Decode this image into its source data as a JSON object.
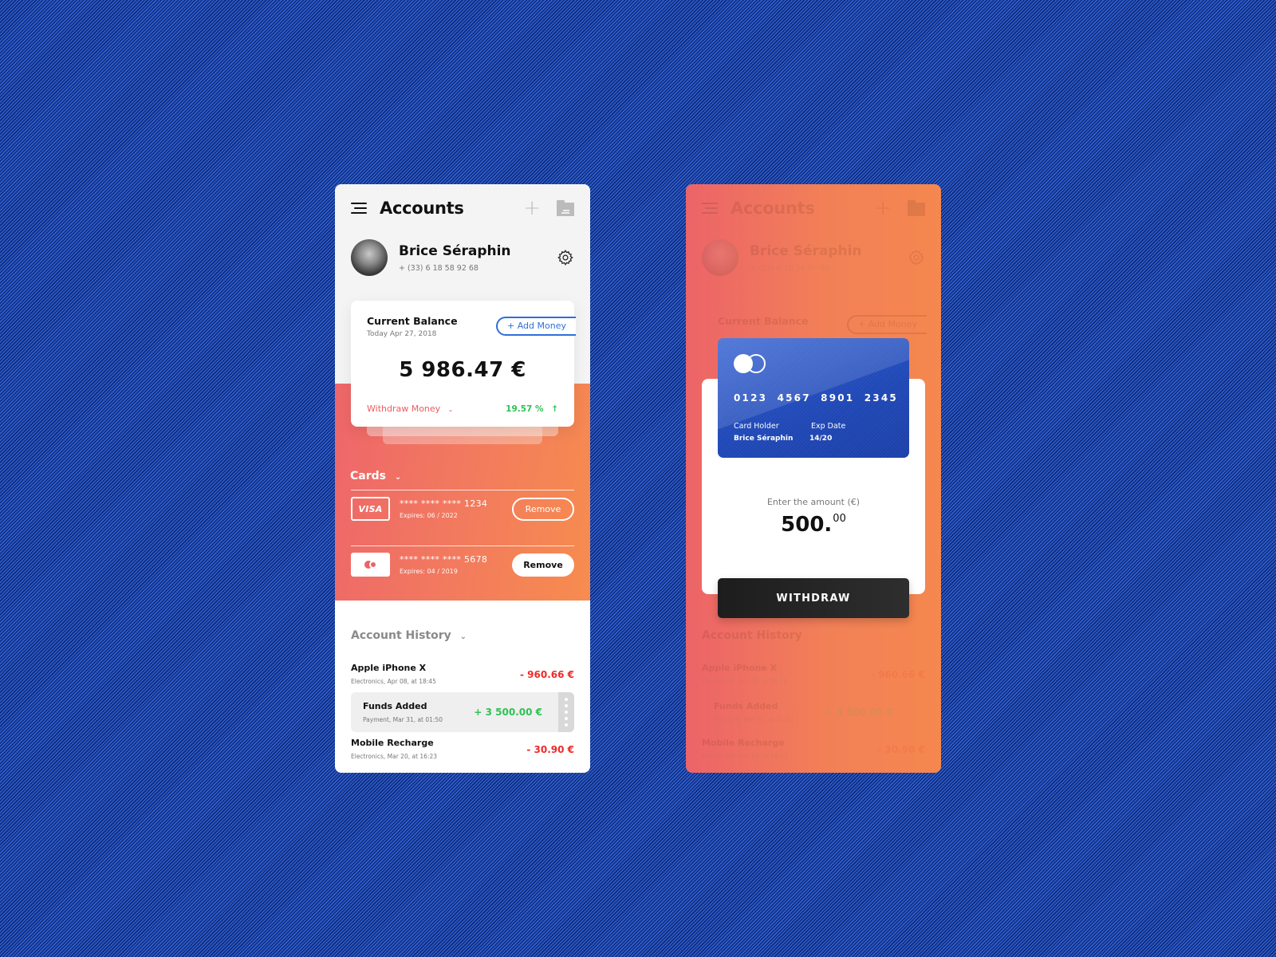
{
  "header": {
    "title": "Accounts",
    "menu_icon": "hamburger-menu-icon",
    "add_icon": "plus-icon",
    "folder_icon": "folder-icon"
  },
  "profile": {
    "name": "Brice Séraphin",
    "phone": "+ (33) 6 18 58 92 68",
    "settings_icon": "gear-icon"
  },
  "balance": {
    "title": "Current Balance",
    "date": "Today Apr 27, 2018",
    "add_money_label": "+ Add Money",
    "amount": "5 986.47 €",
    "withdraw_label": "Withdraw Money",
    "growth": "19.57 %"
  },
  "cards": {
    "title": "Cards",
    "items": [
      {
        "brand": "VISA",
        "number": "**** **** **** 1234",
        "expires": "Expires: 06 / 2022",
        "action": "Remove"
      },
      {
        "brand": "mastercard",
        "number": "**** **** **** 5678",
        "expires": "Expires: 04 / 2019",
        "action": "Remove"
      }
    ]
  },
  "history": {
    "title": "Account History",
    "items": [
      {
        "name": "Apple iPhone X",
        "sub": "Electronics, Apr 08, at 18:45",
        "amount": "- 960.66 €",
        "type": "debit"
      },
      {
        "name": "Funds Added",
        "sub": "Payment, Mar 31, at 01:50",
        "amount": "+ 3 500.00 €",
        "type": "credit"
      },
      {
        "name": "Mobile Recharge",
        "sub": "Electronics, Mar 20, at 16:23",
        "amount": "- 30.90 €",
        "type": "debit"
      }
    ]
  },
  "withdraw_modal": {
    "card_number": "0123 4567 8901 2345",
    "holder_label": "Card Holder",
    "holder_value": "Brice Séraphin",
    "exp_label": "Exp Date",
    "exp_value": "14/20",
    "amount_label": "Enter the amount (€)",
    "amount_int": "500.",
    "amount_dec": "00",
    "button_label": "WITHDRAW"
  },
  "colors": {
    "accent_blue": "#2e6fd9",
    "gradient_start": "#ee666a",
    "gradient_end": "#f78c4f",
    "positive": "#2ec254",
    "negative": "#ef2a2a"
  }
}
